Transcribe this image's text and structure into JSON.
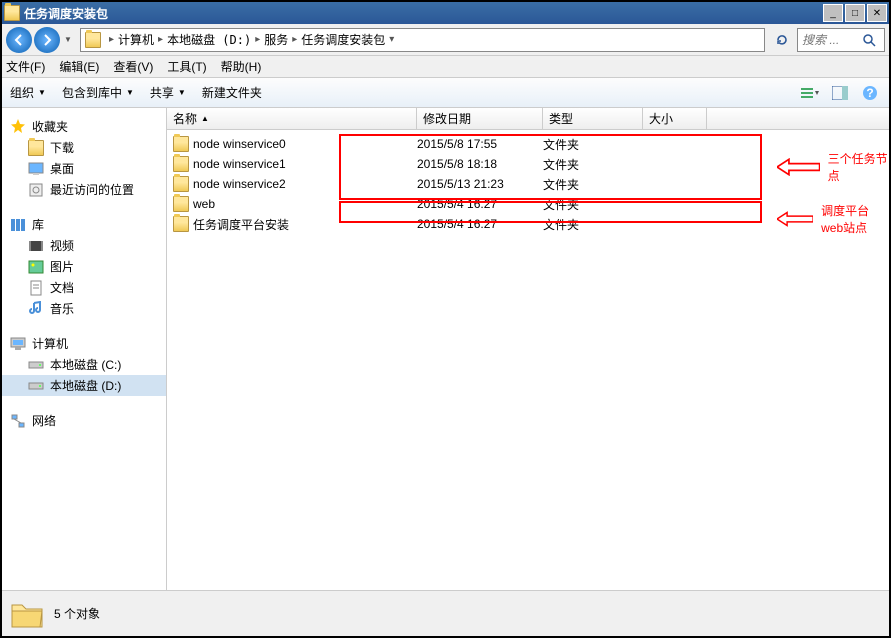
{
  "window": {
    "title": "任务调度安装包"
  },
  "breadcrumb": {
    "items": [
      "计算机",
      "本地磁盘 (D:)",
      "服务",
      "任务调度安装包"
    ]
  },
  "search": {
    "placeholder": "搜索 ..."
  },
  "menubar": {
    "file": "文件(F)",
    "edit": "编辑(E)",
    "view": "查看(V)",
    "tools": "工具(T)",
    "help": "帮助(H)"
  },
  "cmdbar": {
    "organize": "组织",
    "include": "包含到库中",
    "share": "共享",
    "newfolder": "新建文件夹"
  },
  "sidebar": {
    "favorites": {
      "label": "收藏夹",
      "items": [
        "下载",
        "桌面",
        "最近访问的位置"
      ]
    },
    "libraries": {
      "label": "库",
      "items": [
        "视频",
        "图片",
        "文档",
        "音乐"
      ]
    },
    "computer": {
      "label": "计算机",
      "items": [
        "本地磁盘 (C:)",
        "本地磁盘 (D:)"
      ]
    },
    "network": {
      "label": "网络"
    }
  },
  "columns": {
    "name": "名称",
    "date": "修改日期",
    "type": "类型",
    "size": "大小"
  },
  "files": [
    {
      "name": "node winservice0",
      "date": "2015/5/8 17:55",
      "type": "文件夹"
    },
    {
      "name": "node winservice1",
      "date": "2015/5/8 18:18",
      "type": "文件夹"
    },
    {
      "name": "node winservice2",
      "date": "2015/5/13 21:23",
      "type": "文件夹"
    },
    {
      "name": "web",
      "date": "2015/5/4 16:27",
      "type": "文件夹"
    },
    {
      "name": "任务调度平台安装",
      "date": "2015/5/4 16:27",
      "type": "文件夹"
    }
  ],
  "annotations": {
    "a1": "三个任务节点",
    "a2": "调度平台web站点"
  },
  "status": {
    "count": "5 个对象"
  }
}
